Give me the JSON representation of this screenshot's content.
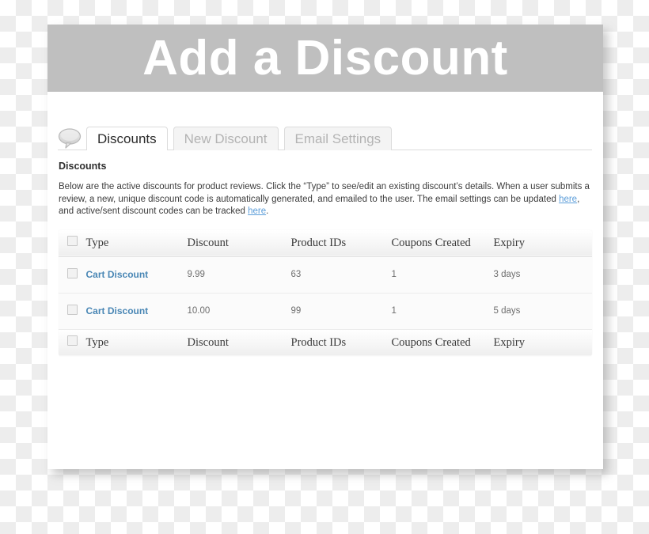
{
  "page": {
    "title": "Add a Discount",
    "title_bar_color": "#bfbfbf"
  },
  "tabs": {
    "icon": "speech-bubble-icon",
    "items": [
      {
        "label": "Discounts",
        "active": true
      },
      {
        "label": "New Discount",
        "active": false
      },
      {
        "label": "Email Settings",
        "active": false
      }
    ]
  },
  "section": {
    "heading": "Discounts",
    "paragraph": {
      "part1": "Below are the active discounts for product reviews. Click the “Type” to see/edit an existing discount’s details. When a user submits a review, a new, unique discount code is automatically generated, and emailed to the user. The email settings can be updated ",
      "link1": "here",
      "part2": ", and active/sent discount codes can be tracked ",
      "link2": "here",
      "part3": "."
    },
    "link_color": "#5b9dd9"
  },
  "table": {
    "columns": [
      "Type",
      "Discount",
      "Product IDs",
      "Coupons Created",
      "Expiry"
    ],
    "rows": [
      {
        "type": "Cart Discount",
        "discount": "9.99",
        "product_ids": "63",
        "coupons_created": "1",
        "expiry": "3 days"
      },
      {
        "type": "Cart Discount",
        "discount": "10.00",
        "product_ids": "99",
        "coupons_created": "1",
        "expiry": "5 days"
      }
    ],
    "link_color": "#4a87b5"
  }
}
